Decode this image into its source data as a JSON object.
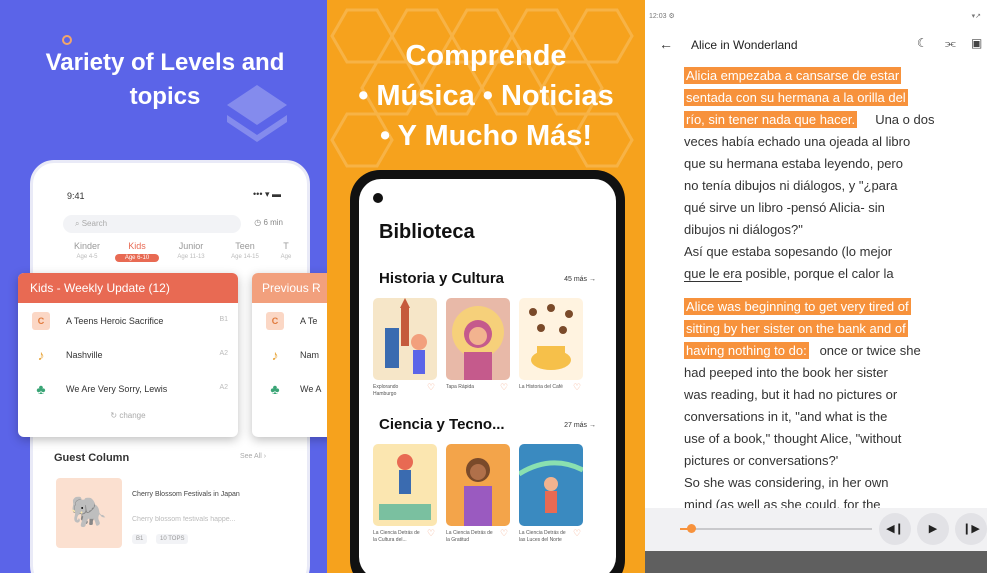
{
  "panel1": {
    "title_line1": "Variety of Levels and",
    "title_line2": "topics",
    "status_time": "9:41",
    "status_icons": "••• ▾ ▬",
    "search_placeholder": "Search",
    "search_right": "6 min",
    "levels": [
      {
        "name": "Kinder",
        "age": "Age 4-5"
      },
      {
        "name": "Kids",
        "age": "Age 6-10"
      },
      {
        "name": "Junior",
        "age": "Age 11-13"
      },
      {
        "name": "Teen",
        "age": "Age 14-15"
      },
      {
        "name": "T",
        "age": "Age"
      }
    ],
    "card_title": "Kids - Weekly Update (12)",
    "card_rows": [
      {
        "text": "A Teens Heroic Sacrifice",
        "level": "B1"
      },
      {
        "text": "Nashville",
        "level": "A2"
      },
      {
        "text": "We Are Very Sorry,  Lewis",
        "level": "A2"
      }
    ],
    "card_footer": "↻ change",
    "card2_title": "Previous R",
    "card2_rows": [
      "A Te",
      "Nam",
      "We A"
    ],
    "guest_title": "Guest Column",
    "see_all": "See All ›",
    "article_title": "Cherry Blossom Festivals in Japan",
    "article_sub": "Cherry blossom festivals happe...",
    "tags": [
      "B1",
      "10 TOPS"
    ]
  },
  "panel2": {
    "title_line1": "Comprende",
    "title_line2": "• Música • Noticias",
    "title_line3": "• Y Mucho Más!",
    "library": "Biblioteca",
    "sections": [
      {
        "title": "Historia y Cultura",
        "more": "45 más →",
        "books": [
          "Explorando Hamburgo",
          "Tapa Rápida",
          "La Historia del Café"
        ]
      },
      {
        "title": "Ciencia y Tecno...",
        "more": "27 más →",
        "books": [
          "La Ciencia Detrás de la Cultura del...",
          "La Ciencia Detrás de la Gratitud",
          "La Ciencia Detrás de las Luces del Norte"
        ]
      }
    ]
  },
  "panel3": {
    "status_time": "12:03 ⚙",
    "status_icons": "▾↗",
    "back": "←",
    "book_title": "Alice in Wonderland",
    "tool_icons": [
      "☾",
      "⫘",
      "▣"
    ],
    "lines": {
      "l1": "Alicia empezaba a cansarse de estar",
      "l2": "sentada con su hermana a la orilla del",
      "l3a": "río, sin tener nada que hacer.",
      "l3b": "Una o dos",
      "l4": "veces había echado una ojeada al libro",
      "l5": "que su hermana estaba leyendo, pero",
      "l6": "no tenía dibujos ni diálogos, y \"¿para",
      "l7": "qué sirve un libro -pensó Alicia- sin",
      "l8": "dibujos ni diálogos?\"",
      "l9": "Así que estaba sopesando (lo mejor",
      "l10a": "que le era",
      "l10b": " posible, porque el calor la",
      "e1": "Alice was beginning to get very tired of",
      "e2": "sitting by her sister on the bank and of",
      "e3a": "having nothing to do:",
      "e3b": "once or twice she",
      "e4": "had peeped into the book her sister",
      "e5": "was reading, but it had no pictures or",
      "e6": "conversations in it, \"and what is the",
      "e7": "use of a book,\" thought Alice, \"without",
      "e8": "pictures or conversations?'",
      "e9": "So she was considering, in her own",
      "e10": "mind (as well as she could, for the"
    },
    "player": {
      "prev": "◀❙",
      "play": "▶",
      "next": "❙▶",
      "progress": 0.05
    }
  }
}
